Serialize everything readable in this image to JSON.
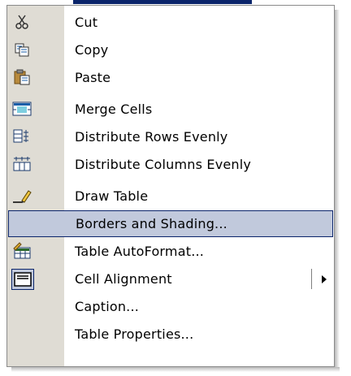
{
  "menu": {
    "items": [
      {
        "label": "Cut",
        "icon": "scissors-icon"
      },
      {
        "label": "Copy",
        "icon": "copy-icon"
      },
      {
        "label": "Paste",
        "icon": "paste-icon"
      },
      {
        "label": "Merge Cells",
        "icon": "merge-cells-icon"
      },
      {
        "label": "Distribute Rows Evenly",
        "icon": "distribute-rows-icon"
      },
      {
        "label": "Distribute Columns Evenly",
        "icon": "distribute-columns-icon"
      },
      {
        "label": "Draw Table",
        "icon": "pencil-icon"
      },
      {
        "label": "Borders and Shading...",
        "icon": null,
        "highlighted": true
      },
      {
        "label": "Table AutoFormat...",
        "icon": "table-autoformat-icon"
      },
      {
        "label": "Cell Alignment",
        "icon": "cell-alignment-icon",
        "submenu": true
      },
      {
        "label": "Caption...",
        "icon": null
      },
      {
        "label": "Table Properties...",
        "icon": null
      }
    ]
  },
  "colors": {
    "highlight": "#c1c9dc",
    "highlight_border": "#0a246a",
    "gutter": "#dfdcd4"
  }
}
